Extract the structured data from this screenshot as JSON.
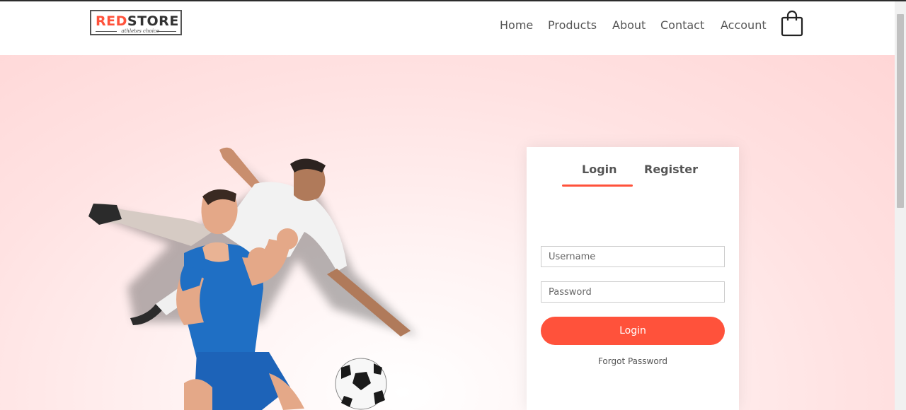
{
  "logo": {
    "red": "RED",
    "dark": "STORE",
    "tagline": "athletes choice"
  },
  "nav": {
    "home": "Home",
    "products": "Products",
    "about": "About",
    "contact": "Contact",
    "account": "Account"
  },
  "cart_icon": "shopping-bag-icon",
  "form": {
    "tab_login": "Login",
    "tab_register": "Register",
    "username_placeholder": "Username",
    "password_placeholder": "Password",
    "submit_label": "Login",
    "forgot_label": "Forgot Password"
  },
  "colors": {
    "accent": "#ff523b",
    "text": "#555555",
    "hero_bg": "#ffd6d6"
  }
}
